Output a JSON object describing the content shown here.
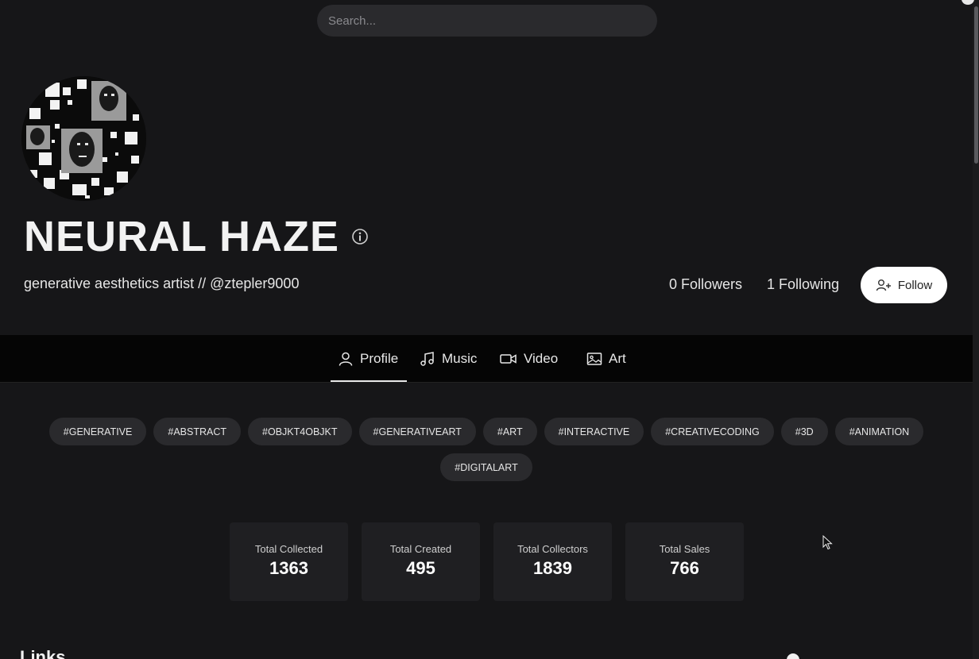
{
  "search": {
    "placeholder": "Search..."
  },
  "profile": {
    "name": "NEURAL HAZE",
    "bio": "generative aesthetics artist // @ztepler9000",
    "followers": "0 Followers",
    "following": "1 Following",
    "follow_label": "Follow"
  },
  "tabs": [
    {
      "label": "Profile",
      "icon": "user-icon"
    },
    {
      "label": "Music",
      "icon": "music-icon"
    },
    {
      "label": "Video",
      "icon": "video-icon"
    },
    {
      "label": "Art",
      "icon": "image-icon"
    }
  ],
  "tags": [
    "#GENERATIVE",
    "#ABSTRACT",
    "#OBJKT4OBJKT",
    "#GENERATIVEART",
    "#ART",
    "#INTERACTIVE",
    "#CREATIVECODING",
    "#3D",
    "#ANIMATION",
    "#DIGITALART"
  ],
  "stats": [
    {
      "label": "Total Collected",
      "value": "1363"
    },
    {
      "label": "Total Created",
      "value": "495"
    },
    {
      "label": "Total Collectors",
      "value": "1839"
    },
    {
      "label": "Total Sales",
      "value": "766"
    }
  ],
  "links_heading": "Links",
  "colors": {
    "background": "#161618",
    "tabbar": "#050505",
    "pill": "#2a2a2d",
    "card": "#1f1f22",
    "follow_button": "#ffffff"
  }
}
